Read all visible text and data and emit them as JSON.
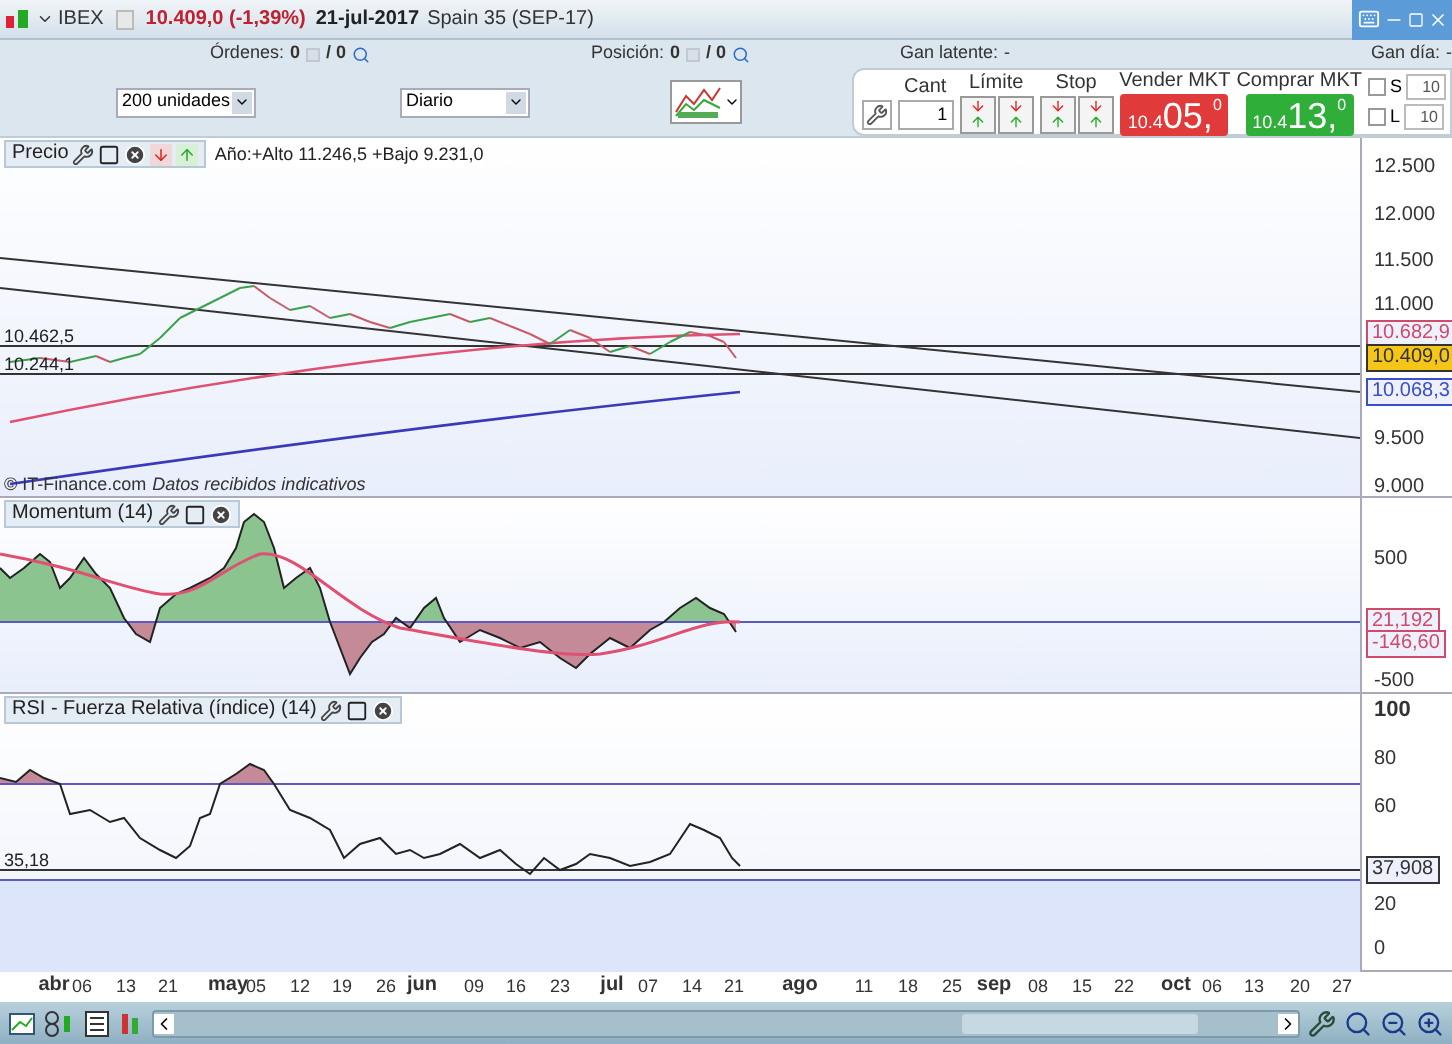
{
  "header": {
    "symbol": "IBEX",
    "price": "10.409,0 (-1,39%)",
    "date": "21-jul-2017",
    "contract": "Spain 35 (SEP-17)"
  },
  "summary": [
    {
      "label": "Órdenes:",
      "value": "0",
      "total": "/ 0",
      "kind": "count"
    },
    {
      "label": "Posición:",
      "value": "0",
      "total": "/ 0",
      "kind": "count"
    },
    {
      "label": "Gan latente:",
      "value": "-",
      "kind": "plain"
    },
    {
      "label": "Gan día:",
      "value": "-",
      "kind": "plain"
    }
  ],
  "controls": {
    "quantity_select": "200 unidades",
    "period_select": "Diario"
  },
  "trade": {
    "cant_label": "Cant",
    "cant_value": "1",
    "limit_label": "Límite",
    "stop_label": "Stop",
    "sell": {
      "label": "Vender MKT",
      "prefix": "10.4",
      "big": "05,",
      "sup": "0"
    },
    "buy": {
      "label": "Comprar MKT",
      "prefix": "10.4",
      "big": "13,",
      "sup": "0"
    },
    "options": [
      {
        "label": "S",
        "value": "10",
        "checked": false
      },
      {
        "label": "L",
        "value": "10",
        "checked": false
      }
    ]
  },
  "price_panel": {
    "title": "Precio",
    "range": "Año:+Alto 11.246,5 +Bajo 9.231,0",
    "left_labels": [
      "10.462,5",
      "10.244,1"
    ],
    "yticks": [
      "12.500",
      "12.000",
      "11.500",
      "11.000",
      "9.500",
      "9.000"
    ],
    "badges": [
      {
        "text": "10.682,9",
        "color": "#d04a6a",
        "highlighted": false
      },
      {
        "text": "10.409,0",
        "color": "#333333",
        "highlighted": true
      },
      {
        "text": "10.068,3",
        "color": "#3a4fc8",
        "highlighted": false
      }
    ],
    "credit": "© IT-Finance.com",
    "note": "Datos recibidos indicativos"
  },
  "momentum_panel": {
    "title": "Momentum (14)",
    "yticks": [
      "500",
      "-500"
    ],
    "badges": [
      {
        "text": "21,192",
        "color": "#d04a6a",
        "highlighted": false
      },
      {
        "text": "-146,60",
        "color": "#d04a6a",
        "highlighted": false
      }
    ]
  },
  "rsi_panel": {
    "title": "RSI - Fuerza Relativa (índice) (14)",
    "left_label": "35,18",
    "yticks": [
      "100",
      "80",
      "60",
      "20",
      "0"
    ],
    "badges": [
      {
        "text": "37,908",
        "color": "#333333",
        "highlighted": false
      }
    ]
  },
  "x_axis": [
    {
      "text": "abr",
      "kind": "month"
    },
    {
      "text": "06",
      "kind": "day"
    },
    {
      "text": "13",
      "kind": "day"
    },
    {
      "text": "21",
      "kind": "day"
    },
    {
      "text": "may",
      "kind": "month"
    },
    {
      "text": "05",
      "kind": "day"
    },
    {
      "text": "12",
      "kind": "day"
    },
    {
      "text": "19",
      "kind": "day"
    },
    {
      "text": "26",
      "kind": "day"
    },
    {
      "text": "jun",
      "kind": "month"
    },
    {
      "text": "09",
      "kind": "day"
    },
    {
      "text": "16",
      "kind": "day"
    },
    {
      "text": "23",
      "kind": "day"
    },
    {
      "text": "jul",
      "kind": "month"
    },
    {
      "text": "07",
      "kind": "day"
    },
    {
      "text": "14",
      "kind": "day"
    },
    {
      "text": "21",
      "kind": "day"
    },
    {
      "text": "ago",
      "kind": "month"
    },
    {
      "text": "11",
      "kind": "day"
    },
    {
      "text": "18",
      "kind": "day"
    },
    {
      "text": "25",
      "kind": "day"
    },
    {
      "text": "sep",
      "kind": "month"
    },
    {
      "text": "08",
      "kind": "day"
    },
    {
      "text": "15",
      "kind": "day"
    },
    {
      "text": "22",
      "kind": "day"
    },
    {
      "text": "oct",
      "kind": "month"
    },
    {
      "text": "06",
      "kind": "day"
    },
    {
      "text": "13",
      "kind": "day"
    },
    {
      "text": "20",
      "kind": "day"
    },
    {
      "text": "27",
      "kind": "day"
    }
  ]
}
